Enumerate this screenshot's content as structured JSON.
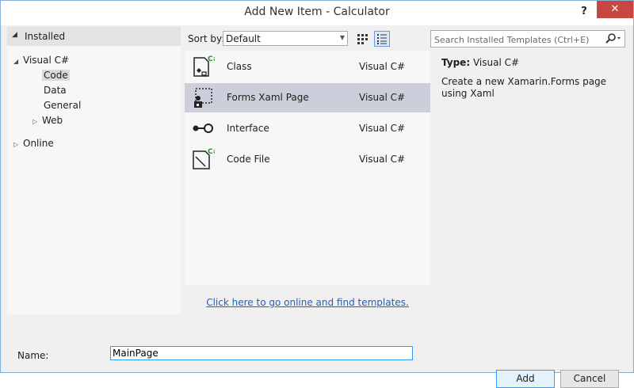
{
  "window": {
    "title": "Add New Item - Calculator",
    "help_label": "?",
    "close_label": "✕"
  },
  "tree": {
    "header": "Installed",
    "nodes": {
      "visual_csharp": "Visual C#",
      "code": "Code",
      "data": "Data",
      "general": "General",
      "web": "Web",
      "online": "Online"
    }
  },
  "toolbar": {
    "sort_label": "Sort by:",
    "sort_value": "Default",
    "search_placeholder": "Search Installed Templates (Ctrl+E)"
  },
  "templates": [
    {
      "name": "Class",
      "language": "Visual C#",
      "icon": "class-icon"
    },
    {
      "name": "Forms Xaml Page",
      "language": "Visual C#",
      "icon": "forms-xaml-page-icon",
      "selected": true
    },
    {
      "name": "Interface",
      "language": "Visual C#",
      "icon": "interface-icon"
    },
    {
      "name": "Code File",
      "language": "Visual C#",
      "icon": "code-file-icon"
    }
  ],
  "online_link": "Click here to go online and find templates.",
  "details": {
    "type_label": "Type:",
    "type_value": "Visual C#",
    "description": "Create a new Xamarin.Forms page using Xaml"
  },
  "footer": {
    "name_label": "Name:",
    "name_value": "MainPage",
    "add_label": "Add",
    "cancel_label": "Cancel"
  },
  "colors": {
    "accent": "#3399ff",
    "selection": "#cccedb",
    "link": "#1f5fbf",
    "close": "#c7463f"
  }
}
